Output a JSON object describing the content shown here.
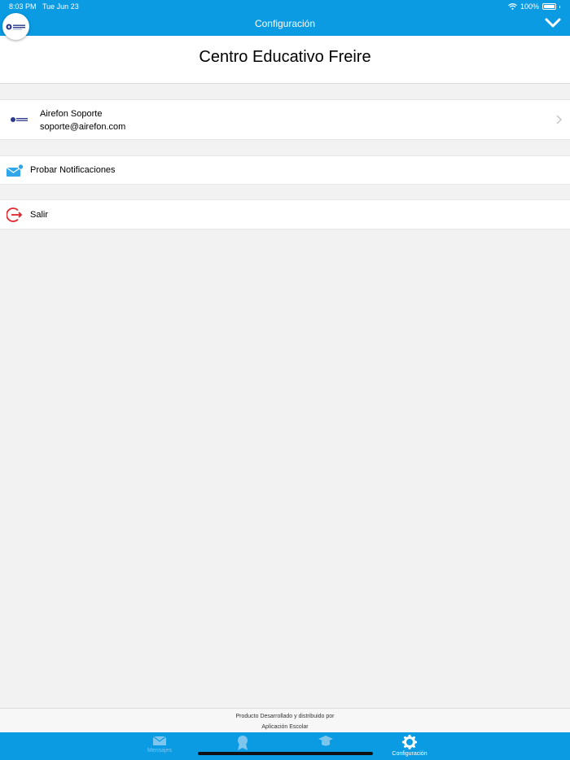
{
  "status_bar": {
    "time": "8:03 PM",
    "date": "Tue Jun 23",
    "battery": "100%"
  },
  "header": {
    "title": "Configuración"
  },
  "school": {
    "name": "Centro Educativo Freire"
  },
  "support": {
    "name": "Airefon Soporte",
    "email": "soporte@airefon.com"
  },
  "actions": {
    "test_notifications": "Probar Notificaciones",
    "logout": "Salir"
  },
  "footer": {
    "line1": "Producto Desarrollado y distribuido por",
    "line2": "Aplicación Escolar"
  },
  "tabs": [
    {
      "label": "Mensajes",
      "icon": "envelope-icon",
      "active": false
    },
    {
      "label": "",
      "icon": "award-icon",
      "active": false
    },
    {
      "label": "",
      "icon": "graduation-cap-icon",
      "active": false
    },
    {
      "label": "Configuración",
      "icon": "gear-icon",
      "active": true
    }
  ],
  "colors": {
    "brand_blue": "#0a9be3",
    "logout_red": "#e0262b"
  }
}
